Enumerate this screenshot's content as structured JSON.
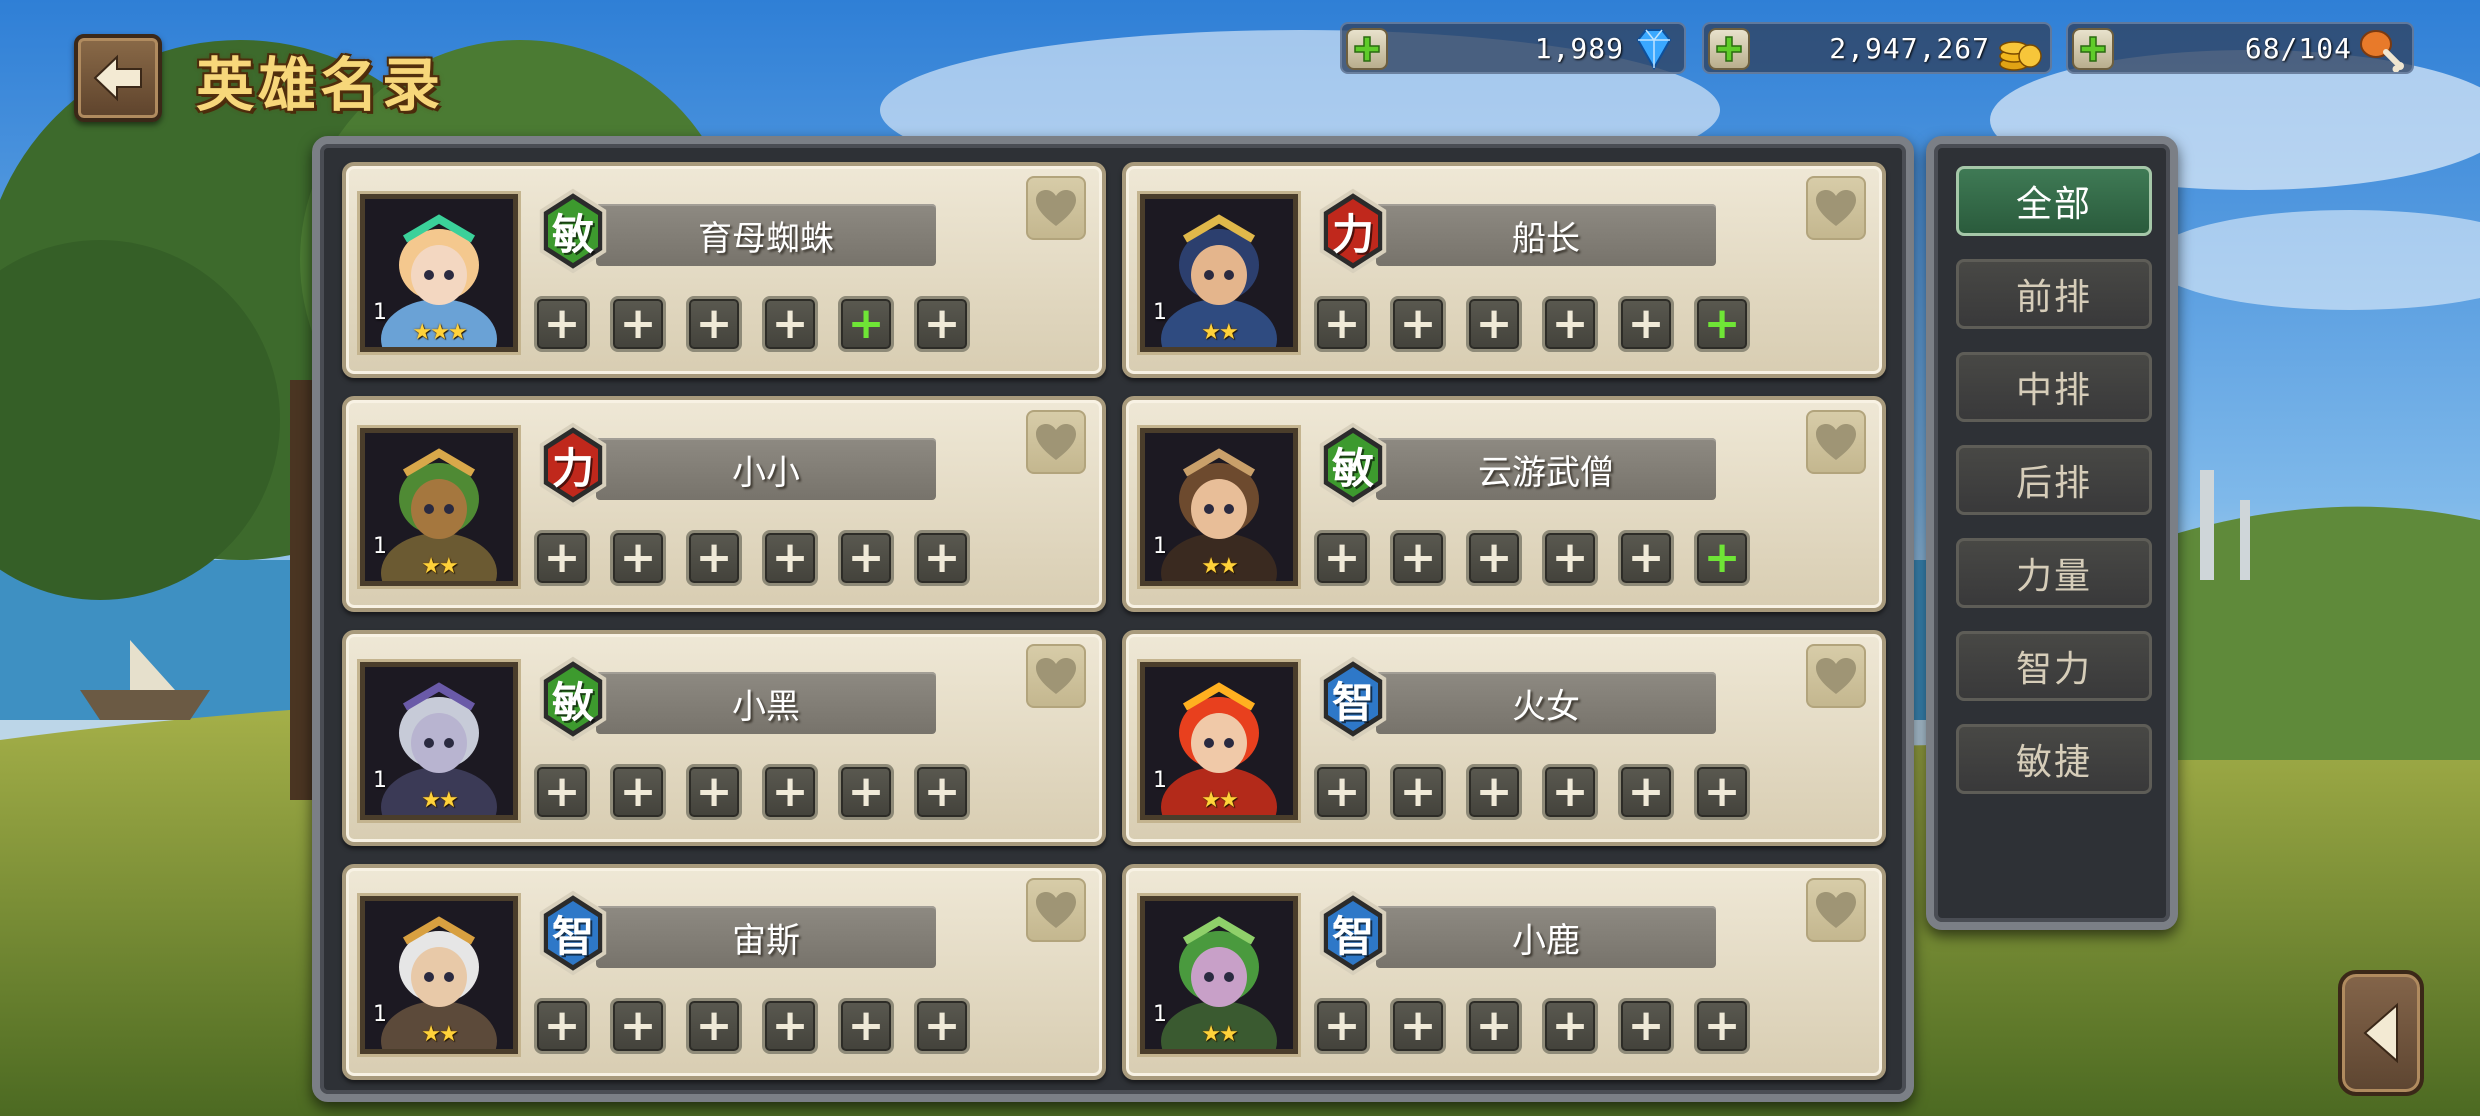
{
  "header": {
    "title": "英雄名录",
    "back_icon": "back-arrow-icon"
  },
  "currencies": [
    {
      "name": "diamond",
      "value": "1,989",
      "icon": "diamond-icon",
      "color": "#3aa8ff"
    },
    {
      "name": "gold",
      "value": "2,947,267",
      "icon": "gold-coins-icon",
      "color": "#f2b61c"
    },
    {
      "name": "stamina",
      "value": "68/104",
      "icon": "drumstick-icon",
      "color": "#e87a2a"
    }
  ],
  "attributes": {
    "敏": {
      "color": "#3d9a2e"
    },
    "力": {
      "color": "#c0281c"
    },
    "智": {
      "color": "#2e78c8"
    }
  },
  "heroes": [
    {
      "name": "育母蜘蛛",
      "attr": "敏",
      "level": "1",
      "stars": "★★★",
      "slots_green": [
        4
      ],
      "portrait": "spider-mother-portrait-icon"
    },
    {
      "name": "船长",
      "attr": "力",
      "level": "1",
      "stars": "★★",
      "slots_green": [
        5
      ],
      "portrait": "captain-portrait-icon"
    },
    {
      "name": "小小",
      "attr": "力",
      "level": "1",
      "stars": "★★",
      "slots_green": [],
      "portrait": "tiny-portrait-icon"
    },
    {
      "name": "云游武僧",
      "attr": "敏",
      "level": "1",
      "stars": "★★",
      "slots_green": [
        5
      ],
      "portrait": "monk-portrait-icon"
    },
    {
      "name": "小黑",
      "attr": "敏",
      "level": "1",
      "stars": "★★",
      "slots_green": [],
      "portrait": "drow-portrait-icon"
    },
    {
      "name": "火女",
      "attr": "智",
      "level": "1",
      "stars": "★★",
      "slots_green": [],
      "portrait": "fire-girl-portrait-icon"
    },
    {
      "name": "宙斯",
      "attr": "智",
      "level": "1",
      "stars": "★★",
      "slots_green": [],
      "portrait": "zeus-portrait-icon"
    },
    {
      "name": "小鹿",
      "attr": "智",
      "level": "1",
      "stars": "★★",
      "slots_green": [],
      "portrait": "deer-portrait-icon"
    }
  ],
  "slot_symbol": "+",
  "filters": [
    {
      "label": "全部",
      "active": true
    },
    {
      "label": "前排",
      "active": false
    },
    {
      "label": "中排",
      "active": false
    },
    {
      "label": "后排",
      "active": false
    },
    {
      "label": "力量",
      "active": false
    },
    {
      "label": "智力",
      "active": false
    },
    {
      "label": "敏捷",
      "active": false
    }
  ]
}
